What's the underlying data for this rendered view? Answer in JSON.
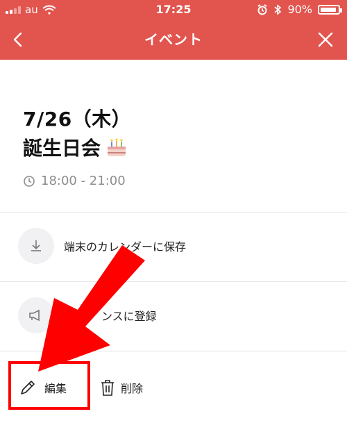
{
  "status_bar": {
    "carrier": "au",
    "time": "17:25",
    "battery": "90%"
  },
  "nav": {
    "title": "イベント"
  },
  "event": {
    "date": "7/26（木）",
    "title": "誕生日会",
    "time_range": "18:00 - 21:00"
  },
  "actions": [
    {
      "label": "端末のカレンダーに保存",
      "icon": "download-icon"
    },
    {
      "label": "ンスに登録",
      "icon": "megaphone-icon"
    }
  ],
  "bottom": {
    "edit_label": "編集",
    "delete_label": "削除"
  },
  "colors": {
    "accent": "#E2554F",
    "highlight": "#ff0000",
    "muted_text": "#8d8d8d",
    "icon_bg": "#f1f1f3"
  }
}
